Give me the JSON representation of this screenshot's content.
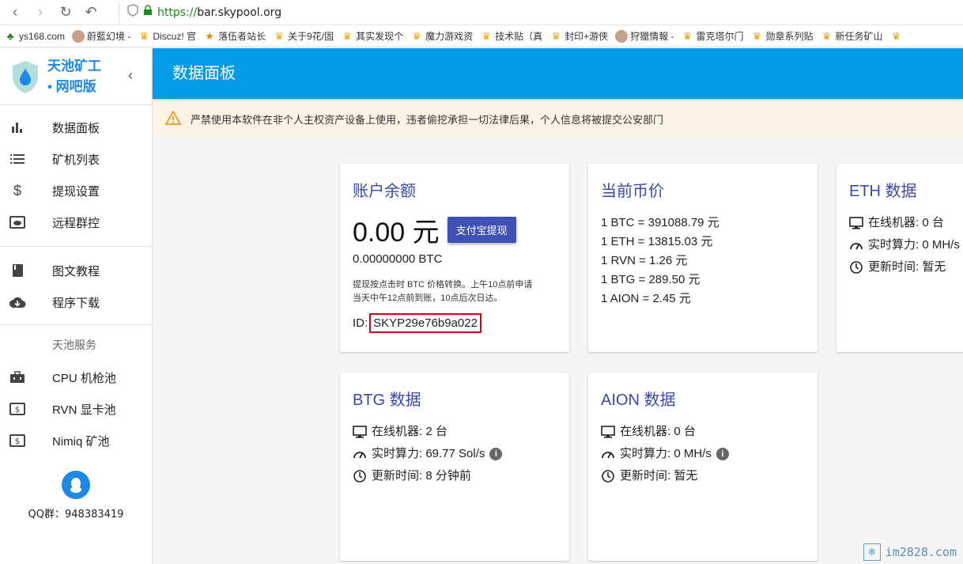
{
  "browser": {
    "url_scheme": "https://",
    "url_host": "bar.skypool.org",
    "bookmarks": [
      {
        "label": "ys168.com",
        "icon": "globe"
      },
      {
        "label": "蔚藍幻境 -",
        "icon": "avatar"
      },
      {
        "label": "Discuz! 官",
        "icon": "cup"
      },
      {
        "label": "落伍者站长",
        "icon": "runner"
      },
      {
        "label": "关于9花/固",
        "icon": "cup"
      },
      {
        "label": "其实发现个",
        "icon": "cup"
      },
      {
        "label": "魔力游戏资",
        "icon": "cup"
      },
      {
        "label": "技术贴（真",
        "icon": "cup"
      },
      {
        "label": "封印+游侠",
        "icon": "cup"
      },
      {
        "label": "狩獵情報 -",
        "icon": "avatar"
      },
      {
        "label": "雷克塔尔门",
        "icon": "cup"
      },
      {
        "label": "勋章系列贴",
        "icon": "cup"
      },
      {
        "label": "新任务矿山",
        "icon": "cup"
      },
      {
        "label": "",
        "icon": "cup"
      }
    ]
  },
  "sidebar": {
    "brand_line1": "天池矿工",
    "brand_line2": "• 网吧版",
    "items": [
      {
        "label": "数据面板",
        "icon": "bar-chart-icon"
      },
      {
        "label": "矿机列表",
        "icon": "list-icon"
      },
      {
        "label": "提现设置",
        "icon": "dollar-icon"
      },
      {
        "label": "远程群控",
        "icon": "cloud-monitor-icon"
      }
    ],
    "items2": [
      {
        "label": "图文教程",
        "icon": "book-icon"
      },
      {
        "label": "程序下载",
        "icon": "cloud-download-icon"
      }
    ],
    "services_header": "天池服务",
    "services": [
      {
        "label": "CPU 机枪池",
        "icon": "toolbox-icon"
      },
      {
        "label": "RVN 显卡池",
        "icon": "money-box-icon"
      },
      {
        "label": "Nimiq 矿池",
        "icon": "money-box-icon"
      }
    ],
    "qq_text": "QQ群：948383419"
  },
  "header": {
    "title": "数据面板"
  },
  "alert": {
    "text": "严禁使用本软件在非个人主权资产设备上使用，违者偷挖承担一切法律后果，个人信息将被提交公安部门"
  },
  "balance": {
    "title": "账户余额",
    "amount": "0.00 元",
    "button": "支付宝提现",
    "btc": "0.00000000 BTC",
    "note_line1": "提现按点击时 BTC 价格转换。上午10点前申请",
    "note_line2": "当天中午12点前到账，10点后次日达。",
    "id_label": "ID:",
    "id_value": "SKYP29e76b9a022"
  },
  "prices": {
    "title": "当前币价",
    "lines": [
      "1 BTC = 391088.79 元",
      "1 ETH = 13815.03 元",
      "1 RVN = 1.26 元",
      "1 BTG = 289.50 元",
      "1 AION = 2.45 元"
    ]
  },
  "eth": {
    "title": "ETH 数据",
    "online": "在线机器: 0 台",
    "hashrate": "实时算力: 0 MH/s",
    "updated": "更新时间: 暂无"
  },
  "btg": {
    "title": "BTG 数据",
    "online": "在线机器: 2 台",
    "hashrate": "实时算力: 69.77 Sol/s",
    "updated": "更新时间: 8 分钟前"
  },
  "aion": {
    "title": "AION 数据",
    "online": "在线机器: 0 台",
    "hashrate": "实时算力: 0 MH/s",
    "updated": "更新时间: 暂无"
  },
  "watermark": "im2828.com",
  "colors": {
    "topbar": "#039be5",
    "accent": "#3f51b5",
    "card_title": "#3949ab",
    "highlight_border": "#d0021b"
  }
}
